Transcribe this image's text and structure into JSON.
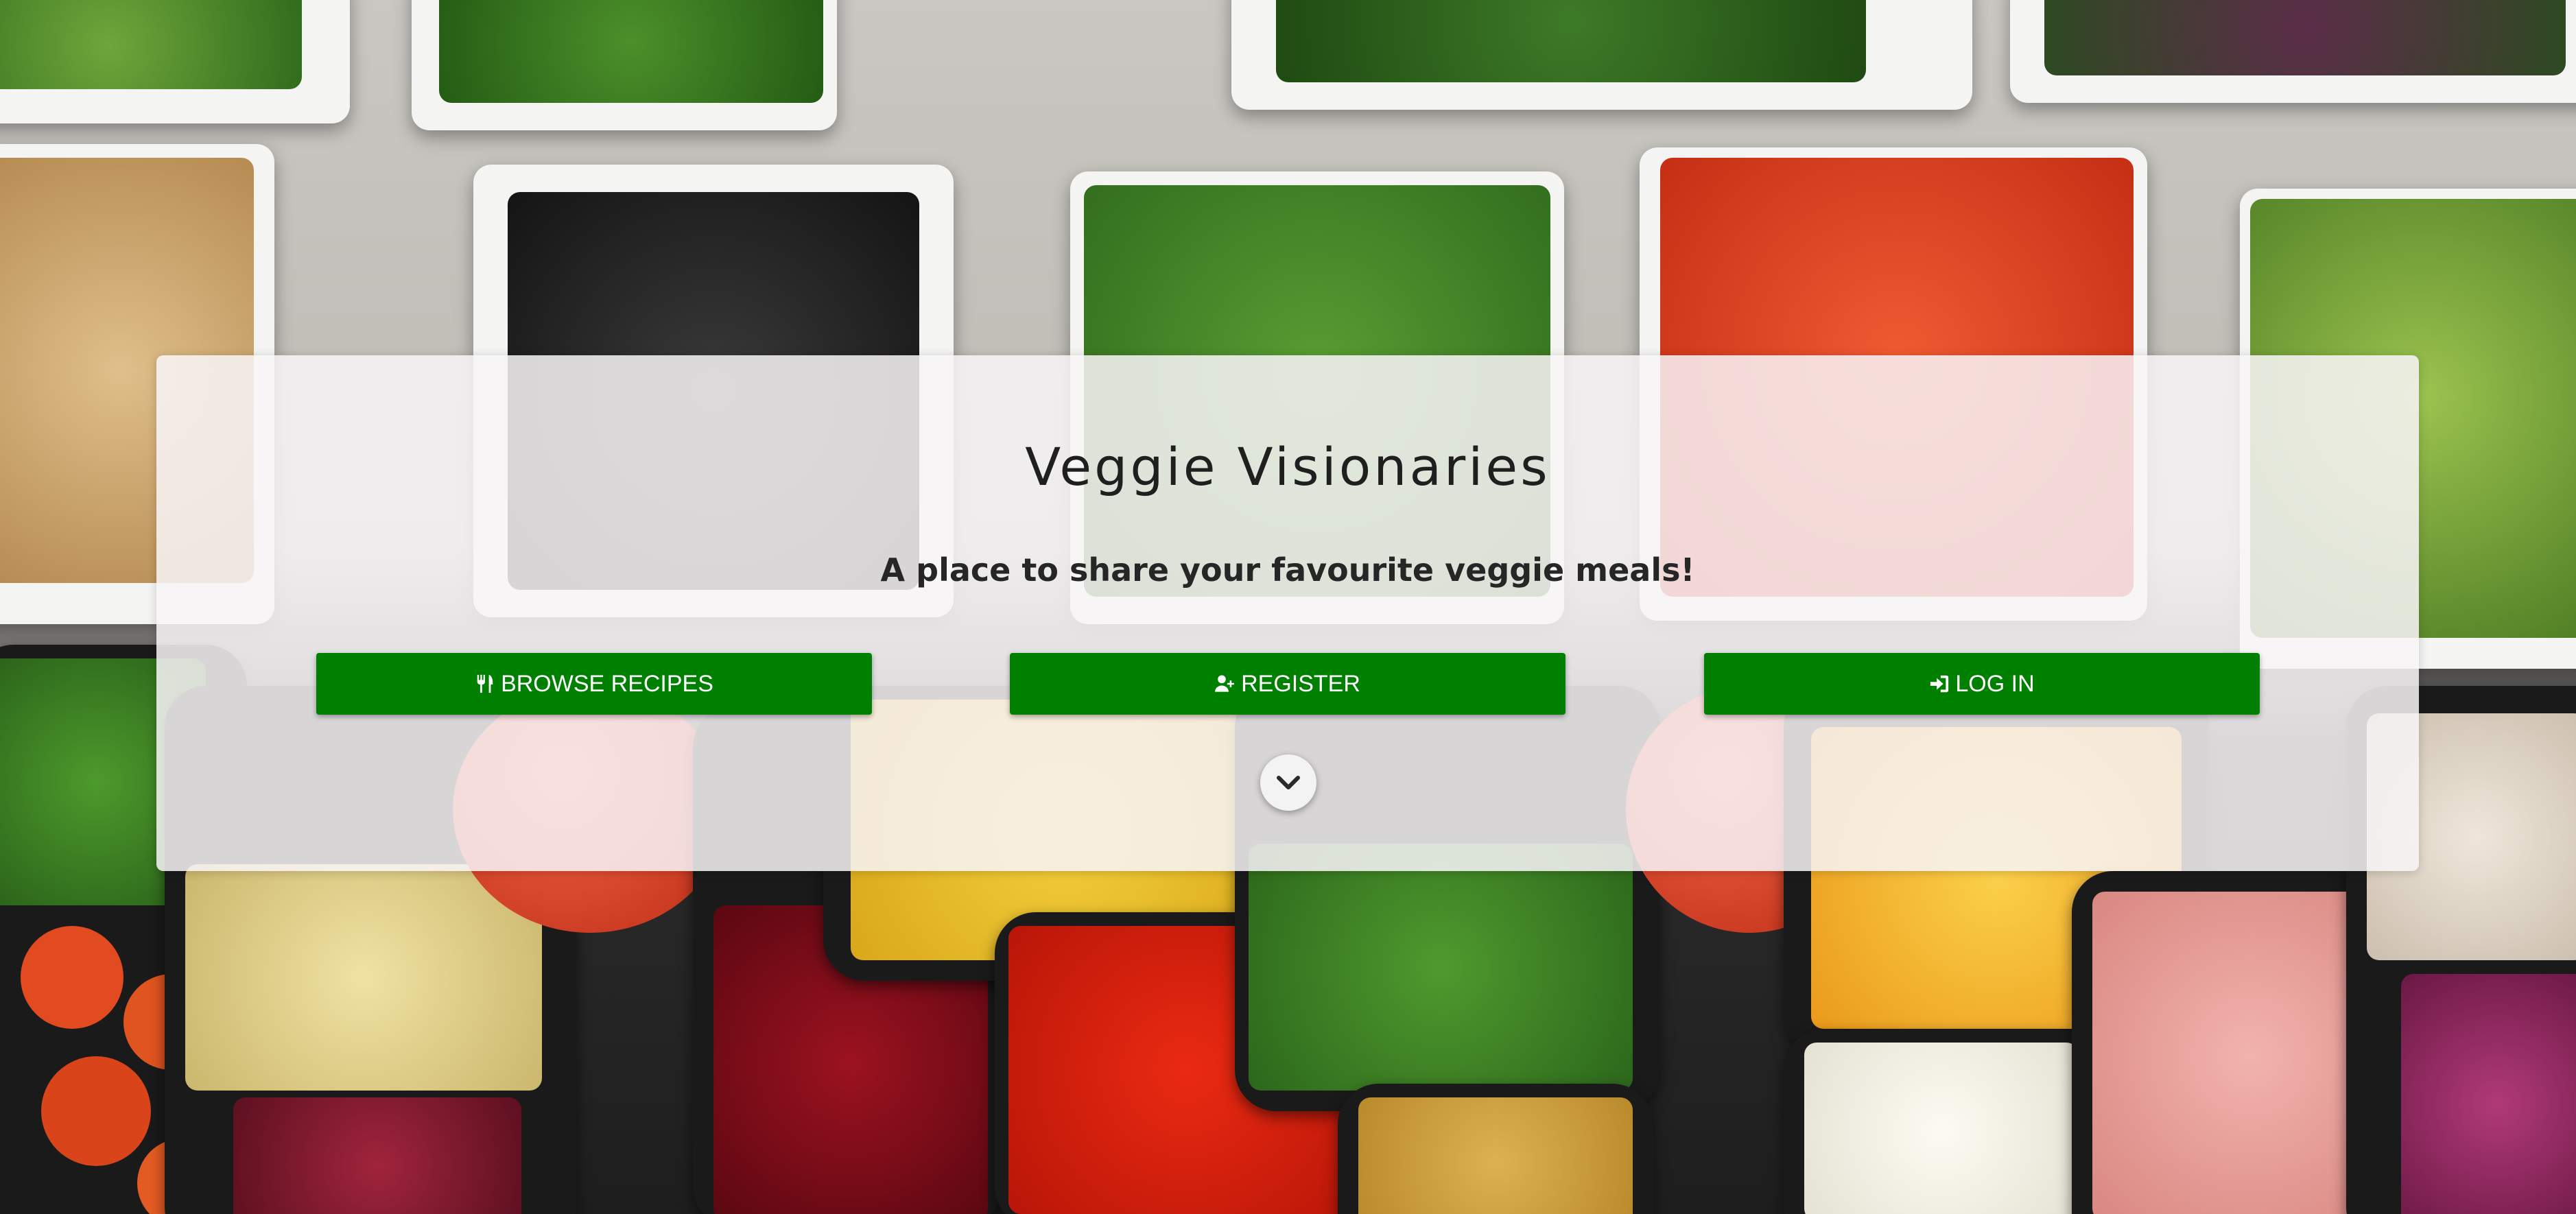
{
  "site": {
    "title": "Veggie Visionaries",
    "tagline": "A place to share your favourite veggie meals!"
  },
  "actions": {
    "browse_label": "BROWSE RECIPES",
    "register_label": "REGISTER",
    "login_label": "LOG IN"
  },
  "icons": {
    "browse": "utensils-icon",
    "register": "user-plus-icon",
    "login": "sign-in-icon",
    "scroll": "chevron-down-icon"
  },
  "colors": {
    "button_bg": "#008000",
    "button_text": "#ffffff",
    "panel_bg": "rgba(248, 244, 247, 0.86)"
  }
}
